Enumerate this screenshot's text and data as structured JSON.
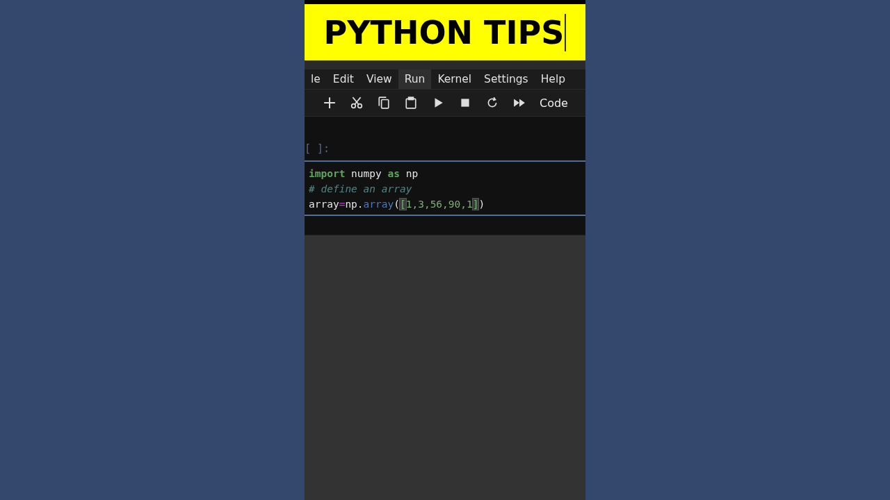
{
  "banner": {
    "title": "PYTHON TIPS"
  },
  "menu": [
    {
      "label": "le",
      "selected": false
    },
    {
      "label": "Edit",
      "selected": false
    },
    {
      "label": "View",
      "selected": false
    },
    {
      "label": "Run",
      "selected": true
    },
    {
      "label": "Kernel",
      "selected": false
    },
    {
      "label": "Settings",
      "selected": false
    },
    {
      "label": "Help",
      "selected": false
    }
  ],
  "toolbar": {
    "buttons": [
      {
        "kind": "add"
      },
      {
        "kind": "cut"
      },
      {
        "kind": "copy"
      },
      {
        "kind": "paste"
      },
      {
        "kind": "run"
      },
      {
        "kind": "stop"
      },
      {
        "kind": "restart"
      },
      {
        "kind": "run-all"
      }
    ],
    "cell_type": "Code"
  },
  "cell": {
    "prompt": "[ ]:",
    "lines": [
      [
        {
          "text": "import",
          "kind": "keyword"
        },
        {
          "text": " numpy ",
          "kind": "plain"
        },
        {
          "text": "as",
          "kind": "keyword"
        },
        {
          "text": " np",
          "kind": "plain"
        }
      ],
      [
        {
          "text": "# define an array",
          "kind": "comment"
        }
      ],
      [
        {
          "text": "array",
          "kind": "plain"
        },
        {
          "text": "=",
          "kind": "operator"
        },
        {
          "text": "np.",
          "kind": "plain"
        },
        {
          "text": "array",
          "kind": "function"
        },
        {
          "text": "(",
          "kind": "plain"
        },
        {
          "text": "[",
          "kind": "match"
        },
        {
          "text": "1,3,56,90,1",
          "kind": "number"
        },
        {
          "text": "]",
          "kind": "match"
        },
        {
          "text": ")",
          "kind": "plain"
        }
      ]
    ]
  }
}
